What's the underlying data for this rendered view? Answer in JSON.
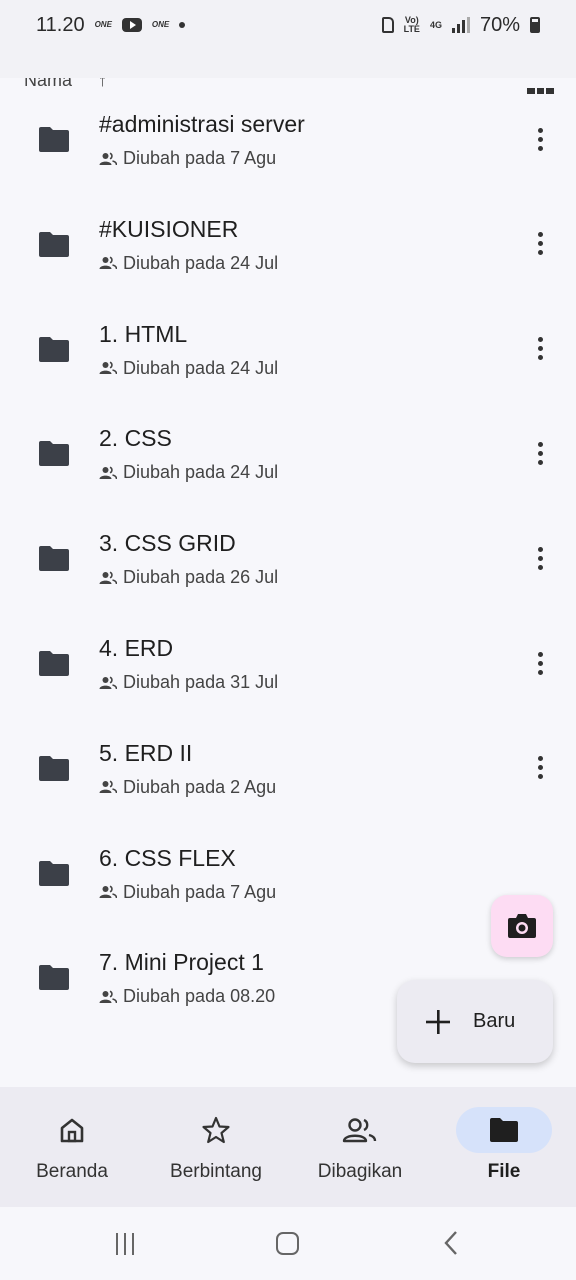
{
  "status_bar": {
    "time": "11.20",
    "battery": "70%",
    "carrier_logo": "ONE",
    "lte_label": "Vo)\nLTE",
    "network_label": "4G"
  },
  "sort": {
    "label": "Nama",
    "arrow": "↑"
  },
  "files": [
    {
      "name": "#administrasi server",
      "meta": "Diubah pada 7 Agu"
    },
    {
      "name": "#KUISIONER",
      "meta": "Diubah pada 24 Jul"
    },
    {
      "name": "1. HTML",
      "meta": "Diubah pada 24 Jul"
    },
    {
      "name": "2. CSS",
      "meta": "Diubah pada 24 Jul"
    },
    {
      "name": "3. CSS GRID",
      "meta": "Diubah pada 26 Jul"
    },
    {
      "name": "4. ERD",
      "meta": "Diubah pada 31 Jul"
    },
    {
      "name": "5. ERD II",
      "meta": "Diubah pada 2 Agu"
    },
    {
      "name": "6. CSS FLEX",
      "meta": "Diubah pada 7 Agu"
    },
    {
      "name": "7. Mini Project 1",
      "meta": "Diubah pada 08.20"
    }
  ],
  "fab": {
    "new_label": "Baru",
    "new_icon": "plus-icon",
    "camera_icon": "camera-icon"
  },
  "bottom_nav": [
    {
      "label": "Beranda",
      "icon": "home-icon",
      "active": false
    },
    {
      "label": "Berbintang",
      "icon": "star-icon",
      "active": false
    },
    {
      "label": "Dibagikan",
      "icon": "people-icon",
      "active": false
    },
    {
      "label": "File",
      "icon": "folder-icon",
      "active": true
    }
  ],
  "colors": {
    "background": "#f7f7fb",
    "nav_background": "#ecebf2",
    "active_pill": "#d6e2fa",
    "camera_fab": "#fddcf3",
    "folder": "#3c4048"
  }
}
